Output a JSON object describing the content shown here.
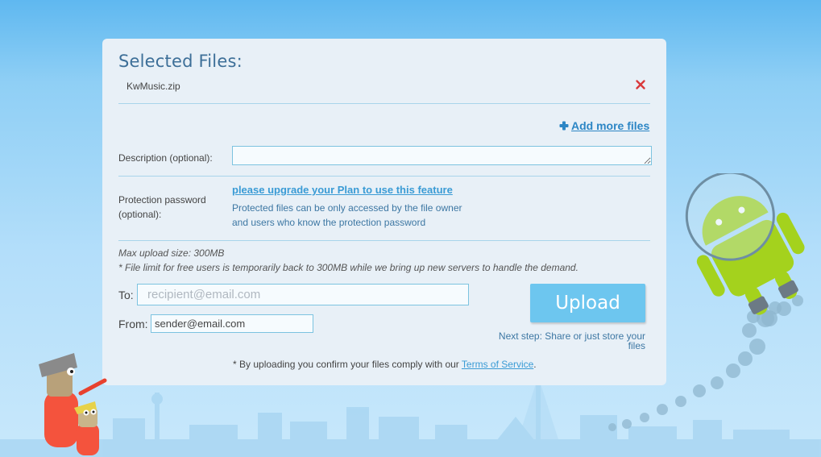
{
  "selected_files": {
    "title": "Selected Files:",
    "files": [
      {
        "name": "KwMusic.zip"
      }
    ],
    "add_more_label": "Add more files"
  },
  "form": {
    "description_label": "Description (optional):",
    "protection_label_line1": "Protection password",
    "protection_label_line2": "(optional):",
    "upgrade_link": "please upgrade your Plan to use this feature",
    "protection_info_line1": "Protected files can be only accessed by the file owner",
    "protection_info_line2": "and users who know the protection password",
    "max_upload": "Max upload size: 300MB",
    "file_limit_note": "* File limit for free users is temporarily back to 300MB while we bring up new servers to handle the demand.",
    "to_label": "To:",
    "to_placeholder": "recipient@email.com",
    "from_label": "From:",
    "from_value": "sender@email.com",
    "upload_button": "Upload",
    "next_step": "Next step: Share or just store your files",
    "tos_prefix": "* By uploading you confirm your files comply with our ",
    "tos_link": "Terms of Service",
    "tos_suffix": "."
  },
  "colors": {
    "accent": "#2c86c5",
    "upload_button": "#6dc6ef",
    "remove_icon": "#d9393b"
  },
  "icons": {
    "remove": "close-icon",
    "add": "plus-icon"
  }
}
